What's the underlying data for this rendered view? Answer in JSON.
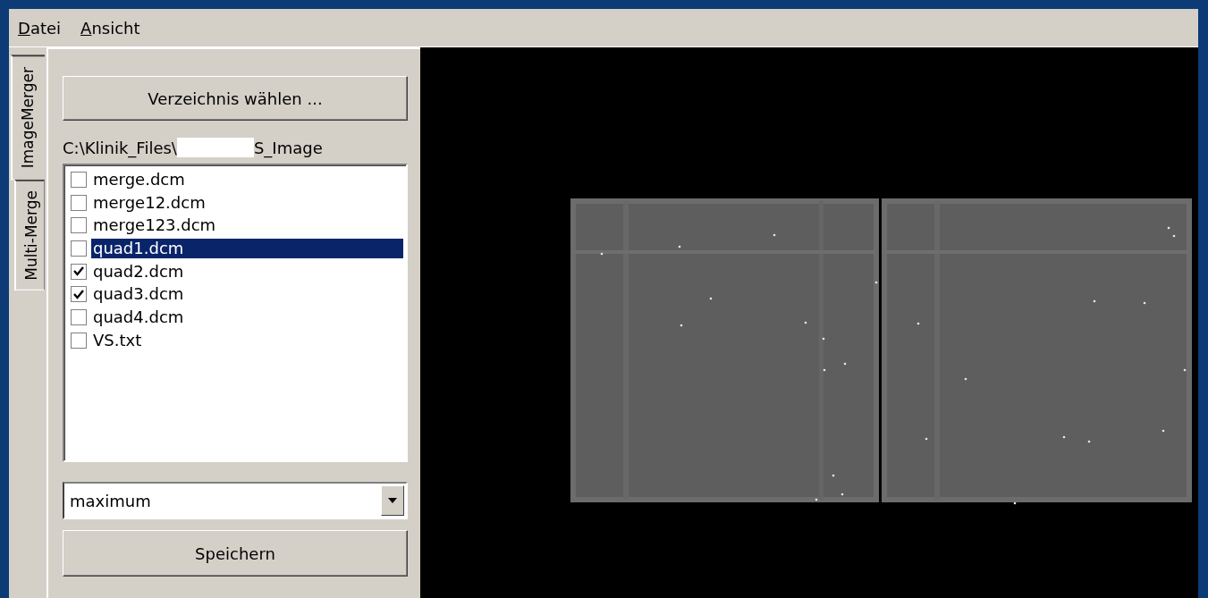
{
  "menu": [
    {
      "label": "Datei"
    },
    {
      "label": "Ansicht"
    }
  ],
  "side_tabs": [
    {
      "label": "ImageMerger",
      "selected": true
    },
    {
      "label": "Multi-Merge",
      "selected": false
    }
  ],
  "choose_folder_button": "Verzeichnis wählen ...",
  "path": {
    "prefix": "C:\\Klinik_Files\\",
    "suffix": "S_Image"
  },
  "files": [
    {
      "name": "merge.dcm",
      "checked": false,
      "selected": false
    },
    {
      "name": "merge12.dcm",
      "checked": false,
      "selected": false
    },
    {
      "name": "merge123.dcm",
      "checked": false,
      "selected": false
    },
    {
      "name": "quad1.dcm",
      "checked": false,
      "selected": true
    },
    {
      "name": "quad2.dcm",
      "checked": true,
      "selected": false
    },
    {
      "name": "quad3.dcm",
      "checked": true,
      "selected": false
    },
    {
      "name": "quad4.dcm",
      "checked": false,
      "selected": false
    },
    {
      "name": "VS.txt",
      "checked": false,
      "selected": false
    }
  ],
  "mode_select": {
    "value": "maximum"
  },
  "save_button": "Speichern"
}
